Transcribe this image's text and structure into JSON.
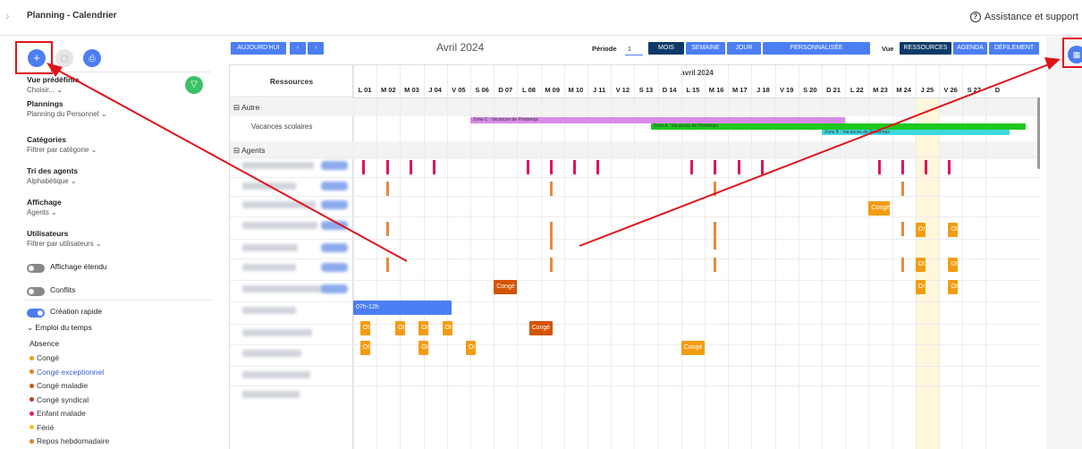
{
  "header": {
    "title": "Planning - Calendrier",
    "help": "Assistance et support"
  },
  "sidebar": {
    "vue_title": "Vue prédéfinie",
    "vue_value": "Choisir... ⌄",
    "plannings_title": "Plannings",
    "plannings_value": "Planning du Personnel ⌄",
    "cat_title": "Catégories",
    "cat_value": "Filtrer par catégorie ⌄",
    "tri_title": "Tri des agents",
    "tri_value": "Alphabétique ⌄",
    "aff_title": "Affichage",
    "aff_value": "Agents ⌄",
    "users_title": "Utilisateurs",
    "users_value": "Filtrer par utilisateurs ⌄",
    "toggle1": "Affichage étendu",
    "toggle2": "Conflits",
    "toggle3": "Création rapide",
    "emploi": "⌄ Emploi du temps",
    "absence": "Absence",
    "legend": [
      {
        "label": "Congé",
        "color": "#f39c12"
      },
      {
        "label": "Congé exceptionnel",
        "color": "#e67e22",
        "active": true
      },
      {
        "label": "Congé maladie",
        "color": "#d35400"
      },
      {
        "label": "Congé syndical",
        "color": "#c0392b"
      },
      {
        "label": "Enfant malade",
        "color": "#e91e63"
      },
      {
        "label": "Férié",
        "color": "#f1c40f"
      },
      {
        "label": "Repos hebdomadaire",
        "color": "#e67e22"
      }
    ]
  },
  "toolbar": {
    "today": "AUJOURD'HUI",
    "prev": "‹",
    "next": "›",
    "month": "Avril 2024",
    "period_label": "Période",
    "period_value": "1",
    "mois": "MOIS",
    "semaine": "SEMAINE",
    "jour": "JOUR",
    "perso": "PERSONNALISÉE",
    "vue_label": "Vue",
    "ressources": "RESSOURCES",
    "agenda": "AGENDA",
    "defilement": "DÉFILEMENT"
  },
  "grid": {
    "res_header": "Ressources",
    "month_header": "avril 2024",
    "days": [
      "L 01",
      "M 02",
      "M 03",
      "J 04",
      "V 05",
      "S 06",
      "D 07",
      "L 08",
      "M 09",
      "M 10",
      "J 11",
      "V 12",
      "S 13",
      "D 14",
      "L 15",
      "M 16",
      "M 17",
      "J 18",
      "V 19",
      "S 20",
      "D 21",
      "L 22",
      "M 23",
      "M 24",
      "J 25",
      "V 26",
      "S 27",
      "D"
    ],
    "group_autre": "⊟ Autre",
    "vacances": "Vacances scolaires",
    "group_agents": "⊟ Agents",
    "zone_c": "Zone C : Vacances de Printemps",
    "zone_a": "Zone A : Vacances de Printemps",
    "zone_b": "Zone B : Vacances de Printemps",
    "conge": "Congé",
    "oi": "OI",
    "slot": "07h-12h"
  },
  "colors": {
    "primary": "#4b7ef2",
    "accent_red": "#e0131b",
    "dark": "#0d3a68",
    "green": "#3cc06a"
  }
}
